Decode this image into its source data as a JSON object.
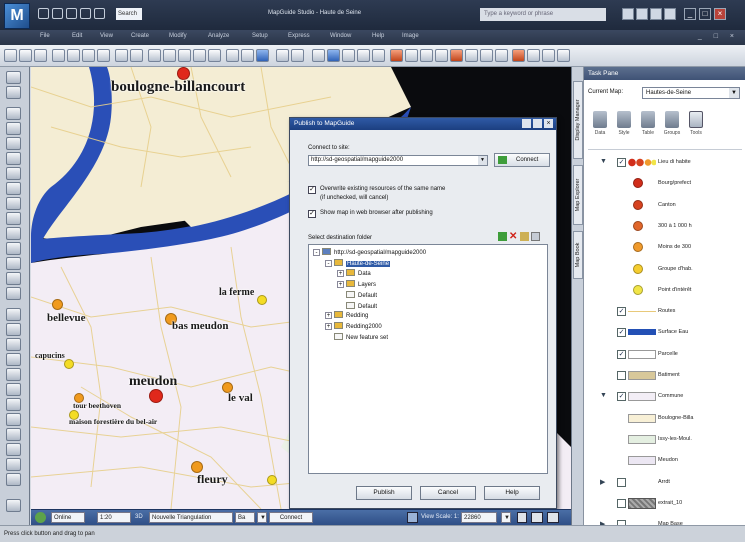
{
  "window": {
    "title": "MapGuide Studio - Haute de Seine",
    "quick_search": "Search",
    "help_search_placeholder": "Type a keyword or phrase"
  },
  "menu": [
    "File",
    "Edit",
    "View",
    "Create",
    "Modify",
    "Analyze",
    "Setup",
    "Express",
    "Window",
    "Help",
    "Image"
  ],
  "map": {
    "places": [
      {
        "id": "boulogne-billancourt",
        "label": "boulogne-billancourt"
      },
      {
        "id": "la-ferme",
        "label": "la ferme"
      },
      {
        "id": "bellevue",
        "label": "bellevue"
      },
      {
        "id": "bas-meudon",
        "label": "bas meudon"
      },
      {
        "id": "capucins",
        "label": "capucins"
      },
      {
        "id": "meudon",
        "label": "meudon"
      },
      {
        "id": "le-val",
        "label": "le val"
      },
      {
        "id": "tour-beethoven",
        "label": "tour beethoven"
      },
      {
        "id": "maison-forestiere",
        "label": "maison forestière du bel-air"
      },
      {
        "id": "fleury",
        "label": "fleury"
      }
    ],
    "status": {
      "drawing_mode": "Online",
      "scale_box": "1:20",
      "view_3d": "3D",
      "coord_system": "Nouvelle Triangulation",
      "coord_unit": "Ba",
      "connect": "Connect",
      "view_scale_label": "View Scale: 1:",
      "view_scale_value": "22860"
    }
  },
  "statusbar": {
    "text": "Press click button and drag to pan"
  },
  "dialog": {
    "title": "Publish to MapGuide",
    "connect_label": "Connect to site:",
    "site_url": "http://sd-geospatial/mapguide2000",
    "connect_button": "Connect",
    "overwrite_label": "Overwrite existing resources of the same name",
    "overwrite_note": "(if unchecked, will cancel)",
    "overwrite_checked": true,
    "show_map_label": "Show map in web browser after publishing",
    "show_map_checked": true,
    "dest_label": "Select destination folder",
    "tree": [
      {
        "label": "http://sd-geospatial/mapguide2000",
        "level": 0,
        "icon": "globe",
        "expander": "-"
      },
      {
        "label": "Haute-de-Seine",
        "level": 1,
        "icon": "folder",
        "expander": "-",
        "selected": true
      },
      {
        "label": "Data",
        "level": 2,
        "icon": "folder",
        "expander": "+"
      },
      {
        "label": "Layers",
        "level": 2,
        "icon": "folder",
        "expander": "+"
      },
      {
        "label": "Default",
        "level": 2,
        "icon": "doc",
        "expander": ""
      },
      {
        "label": "Default",
        "level": 2,
        "icon": "doc",
        "expander": ""
      },
      {
        "label": "Redding",
        "level": 1,
        "icon": "folder",
        "expander": "+"
      },
      {
        "label": "Redding2000",
        "level": 1,
        "icon": "folder",
        "expander": "+"
      },
      {
        "label": "New feature set",
        "level": 1,
        "icon": "doc",
        "expander": ""
      }
    ],
    "buttons": {
      "publish": "Publish",
      "cancel": "Cancel",
      "help": "Help"
    }
  },
  "sidetabs": [
    "Display Manager",
    "Map Explorer",
    "Map Book"
  ],
  "taskpane": {
    "title": "Task Pane",
    "current_map_label": "Current Map:",
    "current_map": "Hautes-de-Seine",
    "tools": [
      "Data",
      "Style",
      "Table",
      "Groups",
      "Tools"
    ],
    "layers": [
      {
        "name": "Lieu di habite",
        "expander": "▼",
        "checked": true,
        "symbol": "points-header"
      },
      {
        "name": "Bourg/prefect",
        "symbol": "dot",
        "color": "#d12d1a"
      },
      {
        "name": "Canton",
        "symbol": "dot",
        "color": "#d6421f"
      },
      {
        "name": "300 à 1 000 h",
        "symbol": "dot",
        "color": "#e0662a"
      },
      {
        "name": "Moins de 300",
        "symbol": "dot",
        "color": "#f09a2c"
      },
      {
        "name": "Groupe d'hab.",
        "symbol": "dot",
        "color": "#f5cd2f"
      },
      {
        "name": "Point d'intérêt",
        "symbol": "dot",
        "color": "#f1e547"
      },
      {
        "name": "Routes",
        "checked": true,
        "symbol": "line",
        "color": "#e8c97a"
      },
      {
        "name": "Surface Eau",
        "checked": true,
        "symbol": "band",
        "color": "#2350b5"
      },
      {
        "name": "Parcelle",
        "checked": true,
        "symbol": "rect",
        "color": "#ffffff"
      },
      {
        "name": "Batiment",
        "checked": false,
        "symbol": "rect",
        "color": "#d8c89a"
      },
      {
        "name": "Commune",
        "expander": "▼",
        "checked": true,
        "symbol": "rect",
        "color": "#f3eef6"
      },
      {
        "name": "Boulogne-Billa",
        "symbol": "rect",
        "color": "#f8f0d6"
      },
      {
        "name": "Issy-les-Moul.",
        "symbol": "rect",
        "color": "#e4efe1"
      },
      {
        "name": "Meudon",
        "symbol": "rect",
        "color": "#ece7f3"
      },
      {
        "name": "Arrdt",
        "expander": "▶",
        "checked": false,
        "symbol": "none"
      },
      {
        "name": "extrait_10",
        "checked": false,
        "symbol": "image"
      },
      {
        "name": "Map Base",
        "expander": "▶",
        "checked": false,
        "symbol": "none"
      }
    ]
  },
  "colors": {
    "water": "#2a4fb7",
    "land_north": "#f4edd4",
    "land_south": "#f3edf5",
    "roads": "#e7cf8a",
    "point_red": "#e0281b",
    "point_orange": "#f09a1e",
    "point_yellow": "#f4dc25"
  }
}
